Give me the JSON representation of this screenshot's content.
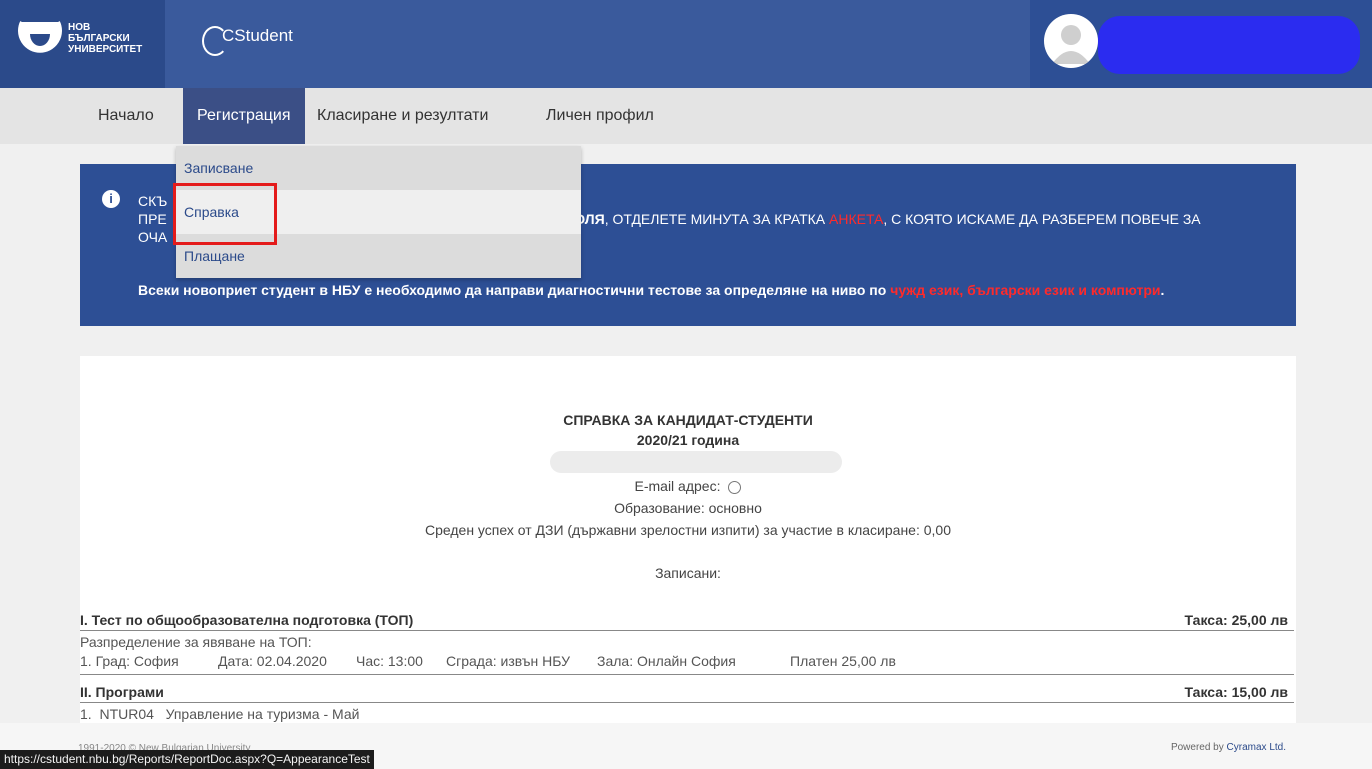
{
  "header": {
    "logo_lines": [
      "НОВ",
      "БЪЛГАРСКИ",
      "УНИВЕРСИТЕТ"
    ],
    "app_name": "CStudent"
  },
  "nav": {
    "items": [
      "Начало",
      "Регистрация",
      "Класиране и резултати",
      "Личен профил"
    ],
    "dropdown": [
      "Записване",
      "Справка",
      "Плащане"
    ]
  },
  "banner": {
    "line1": "СКЪ",
    "line2_start": "ПРЕ",
    "line2_mid": "П, ",
    "line2_bold": "МОЛЯ",
    "line2_after": ", ОТДЕЛЕТЕ МИНУТА ЗА КРАТКА ",
    "line2_red": "АНКЕТА",
    "line2_end": ", С КОЯТО ИСКАМЕ ДА РАЗБЕРЕМ ПОВЕЧЕ ЗА",
    "line3": "ОЧА",
    "notice_bold": "Всеки новоприет студент в НБУ е необходимо да направи диагностични тестове за определяне на ниво по ",
    "notice_red": "чужд език, български език и компютри",
    "notice_end": "."
  },
  "report": {
    "title": "СПРАВКА ЗА КАНДИДАТ-СТУДЕНТИ",
    "year": "2020/21 година",
    "email_label": "E-mail адрес:",
    "education": "Образование: основно",
    "average": "Среден успех от ДЗИ (държавни зрелостни изпити) за участие в класиране: 0,00",
    "enrolled": "Записани:",
    "section1_title": "I. Тест по общообразователна подготовка (ТОП)",
    "section1_fee": "Такса: 25,00 лв",
    "section1_sub": "Разпределение за явяване на ТОП:",
    "section1_row": {
      "num": "1. Град: София",
      "date": "Дата: 02.04.2020",
      "time": "Час: 13:00",
      "building": "Сграда: извън НБУ",
      "hall": "Зала: Онлайн София",
      "paid": "Платен 25,00 лв"
    },
    "section2_title": "II. Програми",
    "section2_fee": "Такса: 15,00 лв",
    "section2_row": "1.  NTUR04   Управление на туризма - Май"
  },
  "footer": {
    "copyright": "1991-2020 © New Bulgarian University",
    "powered_prefix": "Powered by ",
    "powered_link": "Cyramax Ltd."
  },
  "status_url": "https://cstudent.nbu.bg/Reports/ReportDoc.aspx?Q=AppearanceTest"
}
